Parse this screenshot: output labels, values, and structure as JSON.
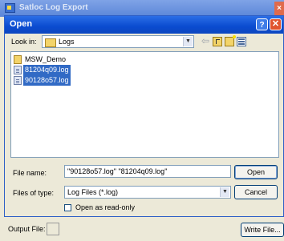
{
  "parent_window": {
    "title": "Satloc Log Export",
    "close_glyph": "×",
    "output_file_label": "Output File:",
    "write_file_button": "Write File..."
  },
  "dialog": {
    "title": "Open",
    "help_glyph": "?",
    "close_glyph": "✕",
    "look_in_label": "Look in:",
    "look_in_value": "Logs",
    "items": [
      {
        "label": "MSW_Demo",
        "type": "folder",
        "selected": false
      },
      {
        "label": "81204q09.log",
        "type": "file",
        "selected": true
      },
      {
        "label": "90128o57.log",
        "type": "file",
        "selected": true
      }
    ],
    "file_name_label": "File name:",
    "file_name_value": "\"90128o57.log\" \"81204q09.log\"",
    "files_of_type_label": "Files of type:",
    "files_of_type_value": "Log Files (*.log)",
    "open_button": "Open",
    "cancel_button": "Cancel",
    "read_only_label": "Open as read-only",
    "read_only_checked": false
  },
  "icons": {
    "back": "back-arrow-icon",
    "up_folder": "up-one-level-icon",
    "new_folder": "new-folder-icon",
    "views_menu": "views-menu-icon",
    "dropdown": "▼"
  },
  "colors": {
    "selection": "#316ac5",
    "title_bar": "#0a4bd0",
    "dialog_bg": "#ece9d8"
  }
}
